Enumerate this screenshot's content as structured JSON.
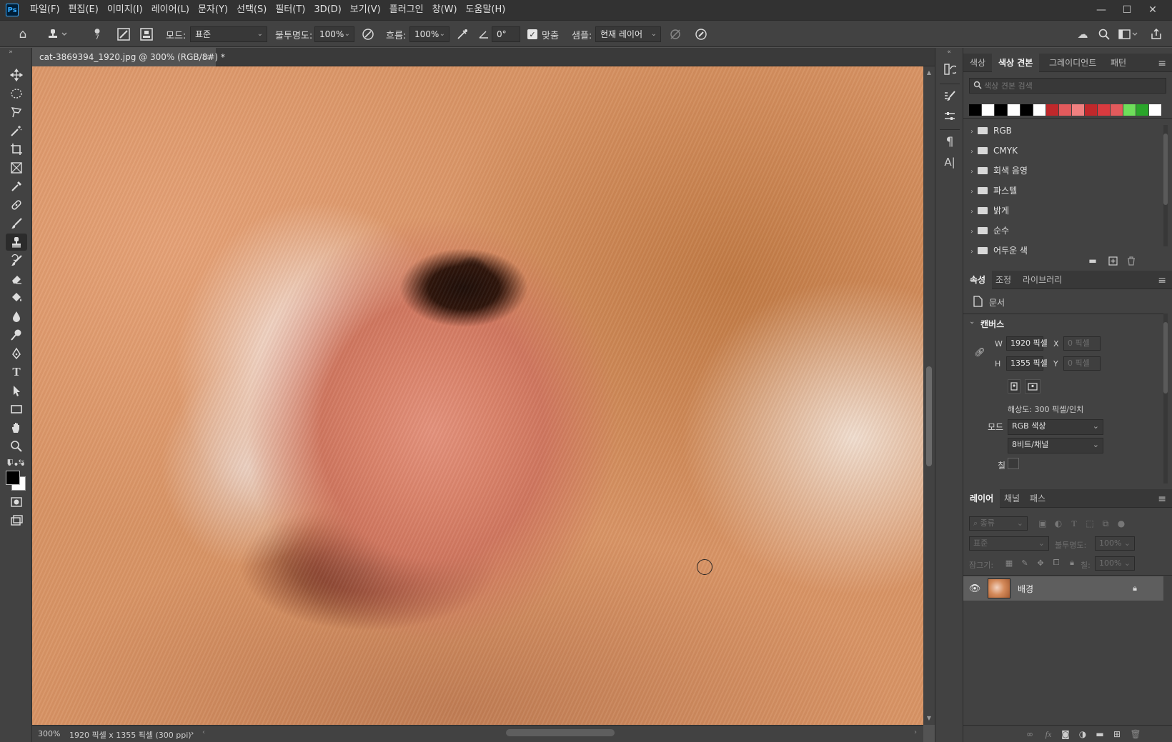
{
  "app": {
    "logo": "Ps"
  },
  "menu": [
    "파일(F)",
    "편집(E)",
    "이미지(I)",
    "레이어(L)",
    "문자(Y)",
    "선택(S)",
    "필터(T)",
    "3D(D)",
    "보기(V)",
    "플러그인",
    "창(W)",
    "도움말(H)"
  ],
  "window_controls": {
    "minimize": "—",
    "maximize": "☐",
    "close": "✕"
  },
  "options": {
    "brush_size": "7",
    "mode_label": "모드:",
    "mode_value": "표준",
    "opacity_label": "불투명도:",
    "opacity_value": "100%",
    "flow_label": "흐름:",
    "flow_value": "100%",
    "angle_value": "0°",
    "aligned_label": "맞춤",
    "aligned_checked": true,
    "sample_label": "샘플:",
    "sample_value": "현재 레이어"
  },
  "document": {
    "tab_title": "cat-3869394_1920.jpg @ 300% (RGB/8#) *",
    "close": "×"
  },
  "status": {
    "zoom": "300%",
    "info": "1920 픽셀 x 1355 픽셀 (300 ppi)",
    "arrow": "›"
  },
  "swatches_panel": {
    "tabs": [
      "색상",
      "색상 견본",
      "그레이디언트",
      "패턴"
    ],
    "active_tab": "색상 견본",
    "search_placeholder": "색상 견본 검색",
    "colors": [
      "#000000",
      "#ffffff",
      "#000000",
      "#ffffff",
      "#000000",
      "#ffffff",
      "#c0282b",
      "#e25a5c",
      "#f08080",
      "#c0282b",
      "#d93a3f",
      "#e25a5c",
      "#6ede5a",
      "#2aa52a",
      "#ffffff"
    ],
    "groups": [
      "RGB",
      "CMYK",
      "회색 음영",
      "파스텔",
      "밝게",
      "순수",
      "어두운 색"
    ]
  },
  "properties_panel": {
    "tabs": [
      "속성",
      "조정",
      "라이브러리"
    ],
    "active_tab": "속성",
    "doc_label": "문서",
    "canvas_heading": "캔버스",
    "w_label": "W",
    "w_value": "1920 픽셀",
    "h_label": "H",
    "h_value": "1355 픽셀",
    "x_label": "X",
    "x_placeholder": "0 픽셀",
    "y_label": "Y",
    "y_placeholder": "0 픽셀",
    "resolution": "해상도: 300 픽셀/인치",
    "mode_label": "모드",
    "mode_value": "RGB 색상",
    "bits_value": "8비트/채널",
    "fill_label": "칠"
  },
  "layers_panel": {
    "tabs": [
      "레이어",
      "채널",
      "패스"
    ],
    "active_tab": "레이어",
    "filter_placeholder": "종류",
    "blend_mode": "표준",
    "opacity_label": "불투명도:",
    "opacity_value": "100%",
    "lock_label": "잠그기:",
    "fill_label": "칠:",
    "fill_value": "100%",
    "layers": [
      {
        "name": "배경",
        "visible": true,
        "locked": true
      }
    ]
  }
}
